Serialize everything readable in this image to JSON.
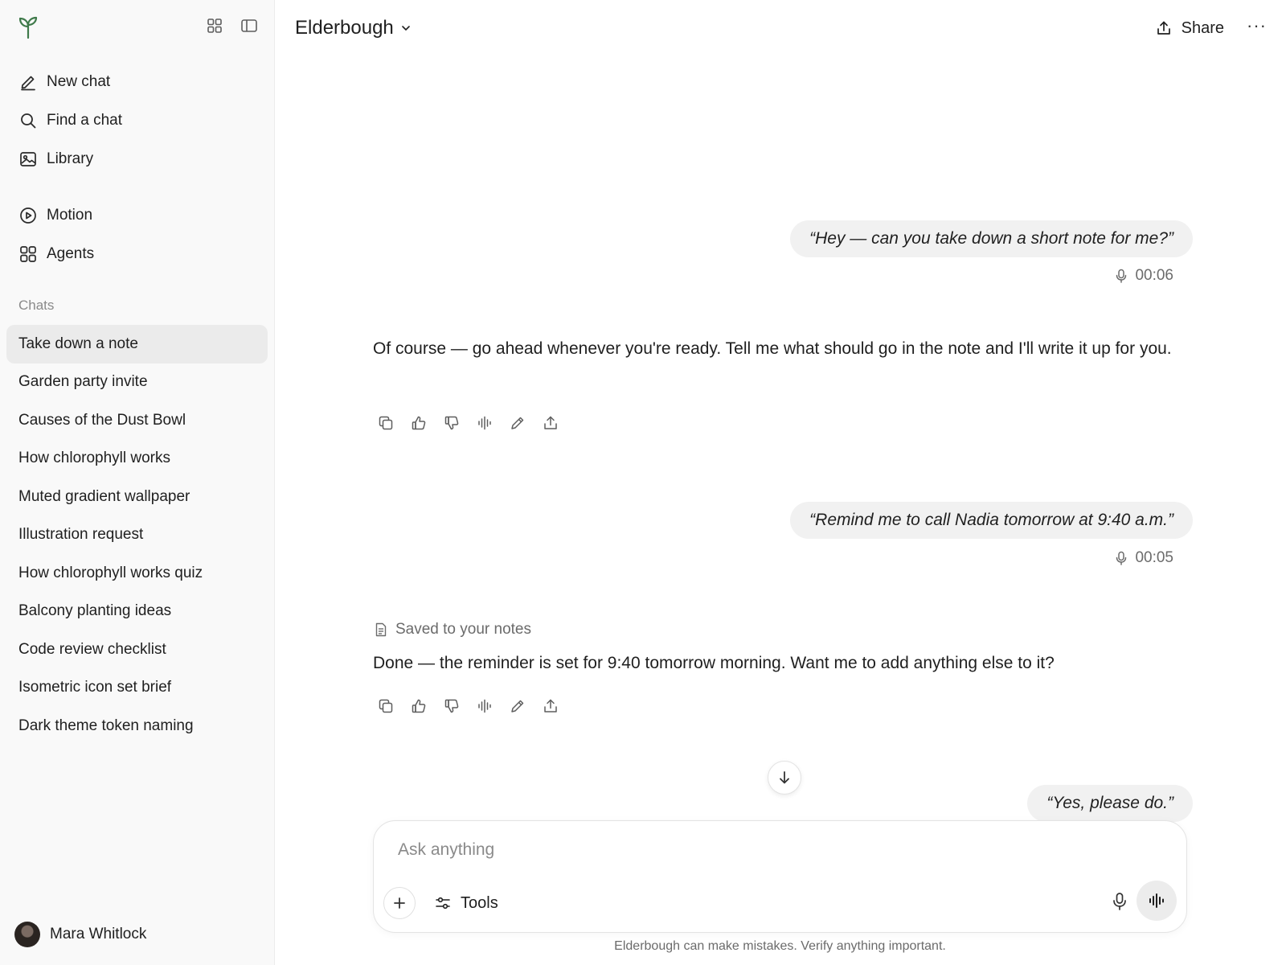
{
  "sidebar": {
    "nav": [
      {
        "label": "New chat",
        "icon": "pencil-icon"
      },
      {
        "label": "Find a chat",
        "icon": "search-icon"
      },
      {
        "label": "Library",
        "icon": "image-icon"
      }
    ],
    "nav2": [
      {
        "label": "Motion",
        "icon": "play-circle-icon"
      },
      {
        "label": "Agents",
        "icon": "grid-icon"
      }
    ],
    "chats_label": "Chats",
    "chats": [
      "Take down a note",
      "Garden party invite",
      "Causes of the Dust Bowl",
      "How chlorophyll works",
      "Muted gradient wallpaper",
      "Illustration request",
      "How chlorophyll works quiz",
      "Balcony planting ideas",
      "Code review checklist",
      "Isometric icon set brief",
      "Dark theme token naming"
    ],
    "active_chat": "Take down a note",
    "user_name": "Mara Whitlock"
  },
  "header": {
    "model": "Elderbough",
    "share_label": "Share",
    "more_label": "···"
  },
  "thread": {
    "user1": "“Hey — can you take down a short note for me?”",
    "user1_duration": "00:06",
    "assistant1": "Of course — go ahead whenever you're ready. Tell me what should go in the note and I'll write it up for you.",
    "user2": "“Remind me to call Nadia tomorrow at 9:40 a.m.”",
    "user2_duration": "00:05",
    "saved_note": "Saved to your notes",
    "assistant2": "Done — the reminder is set for 9:40 tomorrow morning. Want me to add anything else to it?",
    "user3": "“Yes, please do.”"
  },
  "composer": {
    "placeholder": "Ask anything",
    "tools_label": "Tools"
  },
  "disclaimer": "Elderbough can make mistakes. Verify anything important.",
  "colors": {
    "sidebar_bg": "#f9f9f9",
    "active_chat_bg": "#ebebeb",
    "user_bubble_bg": "#f1f1f1",
    "logo": "#3f7a4a"
  }
}
